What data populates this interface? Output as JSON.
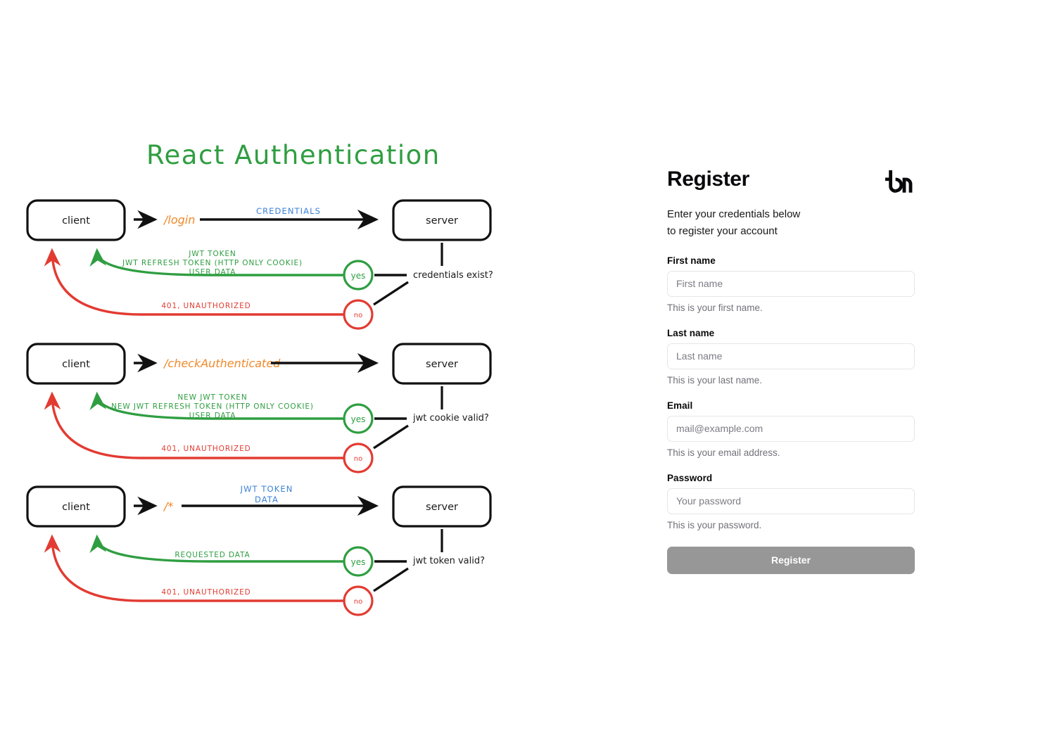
{
  "diagram": {
    "title": "React Authentication",
    "title_color": "#2f9e41",
    "colors": {
      "green": "#2f9e41",
      "red": "#e23b32",
      "orange": "#f0892a",
      "blue": "#3b82d6",
      "black": "#111111"
    },
    "client_label": "client",
    "server_label": "server",
    "yes_label": "yes",
    "no_label": "no",
    "flows": [
      {
        "endpoint": "/login",
        "request_label": "CREDENTIALS",
        "decision": "credentials exist?",
        "success_label": "JWT TOKEN\nJWT REFRESH TOKEN (HTTP ONLY COOKIE)\nUSER DATA",
        "success_lines": [
          "JWT TOKEN",
          "JWT REFRESH TOKEN (HTTP ONLY COOKIE)",
          "USER DATA"
        ],
        "failure_label": "401, UNAUTHORIZED"
      },
      {
        "endpoint": "/checkAuthenticated",
        "request_label": "",
        "decision": "jwt cookie valid?",
        "success_label": "NEW JWT TOKEN\nNEW JWT REFRESH TOKEN (HTTP ONLY COOKIE)\nUSER DATA",
        "success_lines": [
          "NEW JWT TOKEN",
          "NEW JWT REFRESH TOKEN (HTTP ONLY COOKIE)",
          "USER DATA"
        ],
        "failure_label": "401, UNAUTHORIZED"
      },
      {
        "endpoint": "/*",
        "request_label": "JWT TOKEN\nDATA",
        "request_lines": [
          "JWT TOKEN",
          "DATA"
        ],
        "decision": "jwt token valid?",
        "success_label": "REQUESTED DATA",
        "success_lines": [
          "REQUESTED DATA"
        ],
        "failure_label": "401, UNAUTHORIZED"
      }
    ]
  },
  "register": {
    "title": "Register",
    "subtitle": "Enter your credentials below\nto register your account",
    "logo_name": "tm-brand-logo",
    "fields": [
      {
        "label": "First name",
        "placeholder": "First name",
        "value": "",
        "help": "This is your first name."
      },
      {
        "label": "Last name",
        "placeholder": "Last name",
        "value": "",
        "help": "This is your last name."
      },
      {
        "label": "Email",
        "placeholder": "mail@example.com",
        "value": "",
        "help": "This is your email address."
      },
      {
        "label": "Password",
        "placeholder": "Your password",
        "value": "",
        "help": "This is your password."
      }
    ],
    "submit_label": "Register",
    "submit_color": "#979797"
  }
}
